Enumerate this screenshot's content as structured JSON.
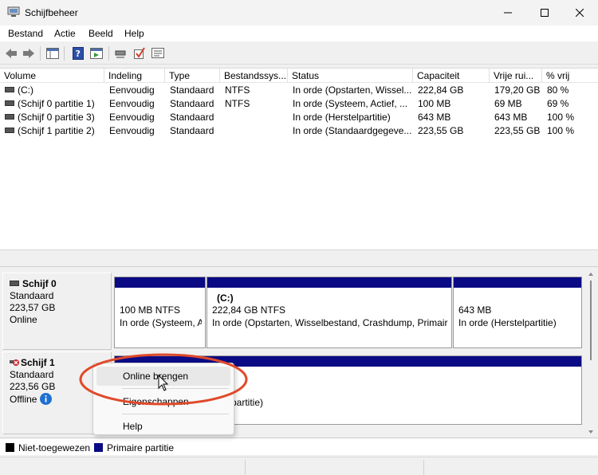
{
  "window": {
    "title": "Schijfbeheer"
  },
  "menu": {
    "items": [
      "Bestand",
      "Actie",
      "Beeld",
      "Help"
    ]
  },
  "volumes": {
    "columns": [
      "Volume",
      "Indeling",
      "Type",
      "Bestandssys...",
      "Status",
      "Capaciteit",
      "Vrije rui...",
      "% vrij"
    ],
    "rows": [
      [
        "(C:)",
        "Eenvoudig",
        "Standaard",
        "NTFS",
        "In orde (Opstarten, Wissel...",
        "222,84 GB",
        "179,20 GB",
        "80 %"
      ],
      [
        "(Schijf 0 partitie 1)",
        "Eenvoudig",
        "Standaard",
        "NTFS",
        "In orde (Systeem, Actief, ...",
        "100 MB",
        "69 MB",
        "69 %"
      ],
      [
        "(Schijf 0 partitie 3)",
        "Eenvoudig",
        "Standaard",
        "",
        "In orde (Herstelpartitie)",
        "643 MB",
        "643 MB",
        "100 %"
      ],
      [
        "(Schijf 1 partitie 2)",
        "Eenvoudig",
        "Standaard",
        "",
        "In orde (Standaardgegeve...",
        "223,55 GB",
        "223,55 GB",
        "100 %"
      ]
    ]
  },
  "disks": [
    {
      "name": "Schijf 0",
      "kind": "Standaard",
      "size": "223,57 GB",
      "state": "Online",
      "partitions": [
        {
          "title": "",
          "line1": "100 MB NTFS",
          "line2": "In orde (Systeem, A"
        },
        {
          "title": "(C:)",
          "line1": "222,84 GB NTFS",
          "line2": "In orde (Opstarten, Wisselbestand, Crashdump, Primaire"
        },
        {
          "title": "",
          "line1": "643 MB",
          "line2": "In orde (Herstelpartitie)"
        }
      ]
    },
    {
      "name": "Schijf 1",
      "kind": "Standaard",
      "size": "223,56 GB",
      "state": "Offline",
      "partitions": [
        {
          "title": "",
          "line1": "",
          "line2": "partitie)"
        }
      ]
    }
  ],
  "context_menu": {
    "items": [
      "Online brengen",
      "Eigenschappen",
      "Help"
    ]
  },
  "legend": {
    "items": [
      "Niet-toegewezen",
      "Primaire partitie"
    ]
  },
  "colors": {
    "primary_partition": "#0a0a84",
    "unallocated": "#000000",
    "annotation": "#e04a2a"
  }
}
